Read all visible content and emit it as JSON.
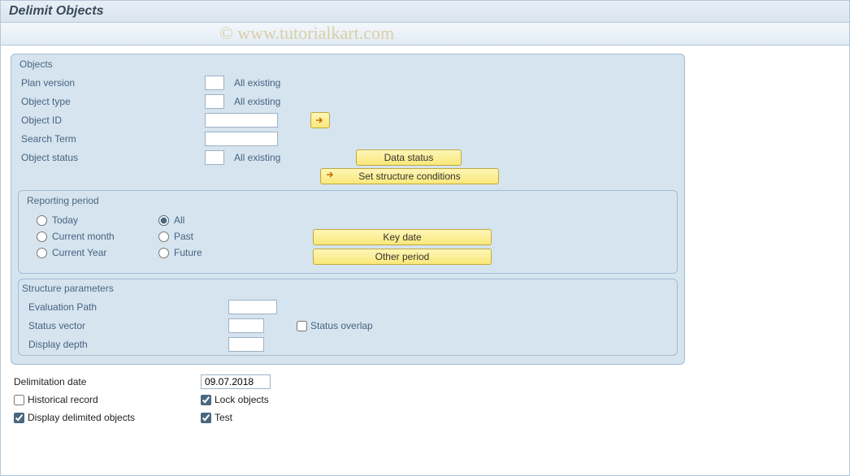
{
  "title": "Delimit Objects",
  "watermark": "© www.tutorialkart.com",
  "objects": {
    "group_title": "Objects",
    "plan_version_label": "Plan version",
    "plan_version_value": "",
    "plan_version_text": "All existing",
    "object_type_label": "Object type",
    "object_type_value": "",
    "object_type_text": "All existing",
    "object_id_label": "Object ID",
    "object_id_value": "",
    "search_term_label": "Search Term",
    "search_term_value": "",
    "object_status_label": "Object status",
    "object_status_value": "",
    "object_status_text": "All existing",
    "data_status_btn": "Data status",
    "set_structure_btn": "Set structure conditions"
  },
  "reporting": {
    "group_title": "Reporting period",
    "today": "Today",
    "all": "All",
    "current_month": "Current month",
    "past": "Past",
    "current_year": "Current Year",
    "future": "Future",
    "key_date_btn": "Key date",
    "other_period_btn": "Other period"
  },
  "structure": {
    "group_title": "Structure parameters",
    "evaluation_path_label": "Evaluation Path",
    "evaluation_path_value": "",
    "status_vector_label": "Status vector",
    "status_vector_value": "",
    "status_overlap_label": "Status overlap",
    "display_depth_label": "Display depth",
    "display_depth_value": ""
  },
  "bottom": {
    "delim_date_label": "Delimitation date",
    "delim_date_value": "09.07.2018",
    "historical_record": "Historical record",
    "lock_objects": "Lock objects",
    "display_delimited": "Display delimited objects",
    "test": "Test"
  }
}
